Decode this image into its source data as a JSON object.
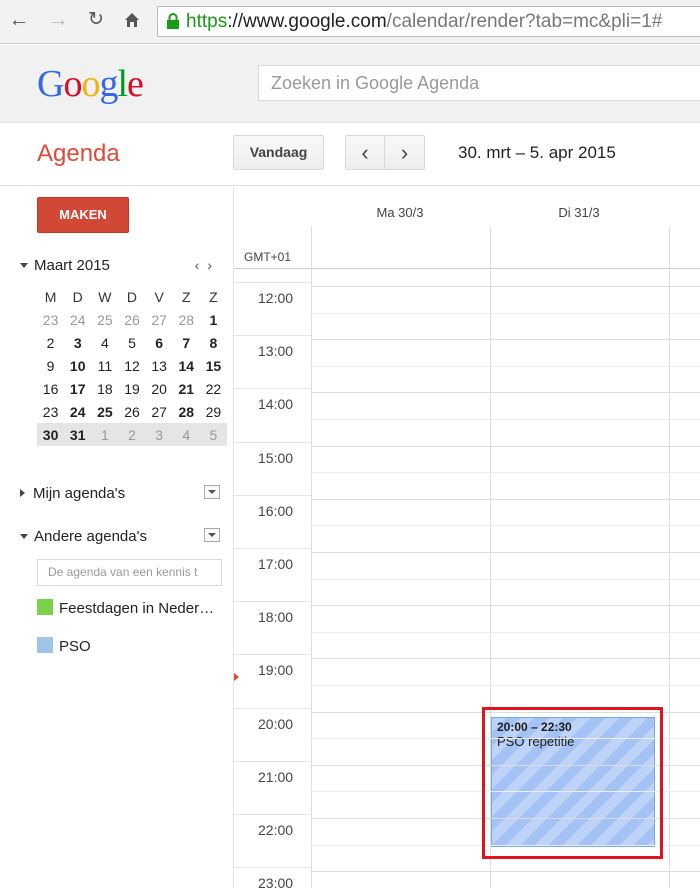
{
  "browser": {
    "url_https": "https",
    "url_host": "://www.google.com",
    "url_path": "/calendar/render?tab=mc&pli=1#"
  },
  "header": {
    "logo_letters": [
      "G",
      "o",
      "o",
      "g",
      "l",
      "e"
    ],
    "logo_colors": [
      "#3369e8",
      "#d50f25",
      "#eeb211",
      "#3369e8",
      "#009925",
      "#d50f25"
    ],
    "search_placeholder": "Zoeken in Google Agenda"
  },
  "appbar": {
    "title": "Agenda",
    "today_label": "Vandaag",
    "prev_label": "‹",
    "next_label": "›",
    "date_range": "30. mrt – 5. apr 2015"
  },
  "sidebar": {
    "create_label": "MAKEN",
    "month_label": "Maart 2015",
    "mini_prev": "‹",
    "mini_next": "›",
    "weekdays": [
      "M",
      "D",
      "W",
      "D",
      "V",
      "Z",
      "Z"
    ],
    "weeks": [
      [
        "23",
        "24",
        "25",
        "26",
        "27",
        "28",
        "1"
      ],
      [
        "2",
        "3",
        "4",
        "5",
        "6",
        "7",
        "8"
      ],
      [
        "9",
        "10",
        "11",
        "12",
        "13",
        "14",
        "15"
      ],
      [
        "16",
        "17",
        "18",
        "19",
        "20",
        "21",
        "22"
      ],
      [
        "23",
        "24",
        "25",
        "26",
        "27",
        "28",
        "29"
      ],
      [
        "30",
        "31",
        "1",
        "2",
        "3",
        "4",
        "5"
      ]
    ],
    "my_calendars": "Mijn agenda's",
    "other_calendars": "Andere agenda's",
    "add_colleague_placeholder": "De agenda van een kennis t",
    "calendars": [
      {
        "label": "Feestdagen in Neder…",
        "color": "#7bd148"
      },
      {
        "label": "PSO",
        "color": "#9fc6e7"
      }
    ]
  },
  "grid": {
    "timezone": "GMT+01",
    "days": [
      "Ma 30/3",
      "Di 31/3"
    ],
    "hours": [
      "12:00",
      "13:00",
      "14:00",
      "15:00",
      "16:00",
      "17:00",
      "18:00",
      "19:00",
      "20:00",
      "21:00",
      "22:00",
      "23:00"
    ]
  },
  "event": {
    "time": "20:00 – 22:30",
    "title": "PSO repetitie",
    "color": "#a4c2f4"
  }
}
